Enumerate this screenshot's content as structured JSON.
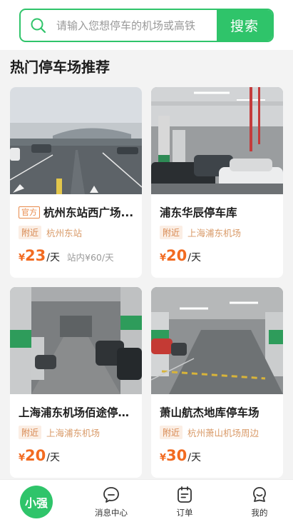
{
  "search": {
    "placeholder": "请输入您想停车的机场或高铁",
    "button_label": "搜索"
  },
  "section_title": "热门停车场推荐",
  "cards": [
    {
      "official_tag": "官方",
      "name": "杭州东站西广场...",
      "near_tag": "附近",
      "location": "杭州东站",
      "currency": "¥",
      "price": "23",
      "unit": "/天",
      "ref_price": "站内¥60/天"
    },
    {
      "name": "浦东华辰停车库",
      "near_tag": "附近",
      "location": "上海浦东机场",
      "currency": "¥",
      "price": "20",
      "unit": "/天"
    },
    {
      "name": "上海浦东机场佰途停车...",
      "near_tag": "附近",
      "location": "上海浦东机场",
      "currency": "¥",
      "price": "20",
      "unit": "/天"
    },
    {
      "name": "萧山航杰地库停车场",
      "near_tag": "附近",
      "location": "杭州萧山机场周边",
      "currency": "¥",
      "price": "30",
      "unit": "/天"
    }
  ],
  "nav": {
    "home_label": "小强",
    "messages_label": "消息中心",
    "orders_label": "订单",
    "mine_label": "我的"
  },
  "colors": {
    "accent": "#2fc46a",
    "price": "#f26b21",
    "tag": "#d7864e"
  }
}
